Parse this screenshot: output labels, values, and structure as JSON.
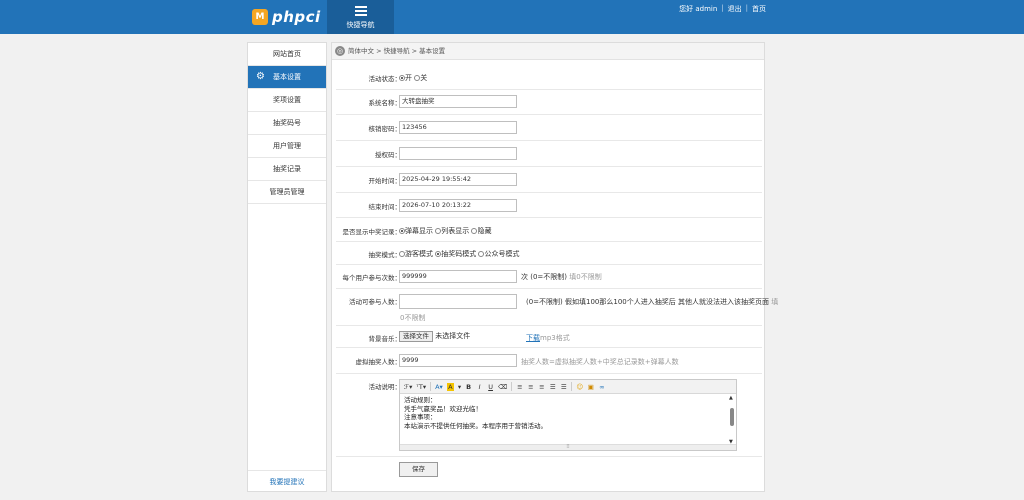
{
  "header": {
    "logo_letter": "M",
    "logo_text": "phpci",
    "quick_nav_label": "快捷导航",
    "greeting": "您好 admin",
    "logout": "退出",
    "home": "首页",
    "bg_color": "#2273b8"
  },
  "sidebar": {
    "items": [
      {
        "label": "网站首页"
      },
      {
        "label": "基本设置"
      },
      {
        "label": "奖项设置"
      },
      {
        "label": "抽奖码号"
      },
      {
        "label": "用户管理"
      },
      {
        "label": "抽奖记录"
      },
      {
        "label": "管理员管理"
      }
    ],
    "footer": "我要提建议"
  },
  "breadcrumb": "简体中文 > 快捷导航 > 基本设置",
  "form": {
    "status": {
      "label": "活动状态：",
      "on": "开",
      "off": "关"
    },
    "system_name": {
      "label": "系统名称：",
      "value": "大转盘抽奖"
    },
    "lottery_code": {
      "label": "核销密码：",
      "value": "123456"
    },
    "auth_code": {
      "label": "授权码：",
      "value": ""
    },
    "start_time": {
      "label": "开始时间：",
      "value": "2025-04-29 19:55:42"
    },
    "end_time": {
      "label": "结束时间：",
      "value": "2026-07-10 20:13:22"
    },
    "show_records": {
      "label": "是否显示中奖记录：",
      "opt1": "弹幕显示",
      "opt2": "列表显示",
      "opt3": "隐藏"
    },
    "lottery_mode": {
      "label": "抽奖模式：",
      "opt1": "游客模式",
      "opt2": "抽奖码模式",
      "opt3": "公众号模式"
    },
    "per_user": {
      "label": "每个用户参与次数：",
      "value": "999999",
      "unit": "次",
      "note": "(0=不限制)",
      "hint": "填0不限制"
    },
    "max_people": {
      "label": "活动可参与人数：",
      "value": "",
      "note": "(0=不限制)",
      "desc": "假如填100那么100个人进入抽奖后 其他人就没法进入该抽奖页面",
      "hint1": "填",
      "hint2": "0不限制"
    },
    "music": {
      "label": "背景音乐：",
      "btn": "选择文件",
      "nofile": "未选择文件",
      "download": "下载",
      "fmt": "mp3格式"
    },
    "virtual": {
      "label": "虚拟抽奖人数：",
      "value": "9999",
      "hint": "抽奖人数=虚拟抽奖人数+中奖总记录数+弹幕人数"
    },
    "desc": {
      "label": "活动说明：",
      "lines": [
        "活动规则：",
        "凭手气赢奖品！欢迎光临！",
        "注意事项：",
        "本站演示不提供任何抽奖。本程序用于营销活动。"
      ]
    },
    "save": "保存"
  },
  "editor_toolbar": [
    "字体",
    "字号",
    "A",
    "A",
    "B",
    "I",
    "U",
    "橡皮",
    "左",
    "中",
    "右",
    "有序",
    "无序",
    "表情",
    "图片",
    "链接"
  ]
}
